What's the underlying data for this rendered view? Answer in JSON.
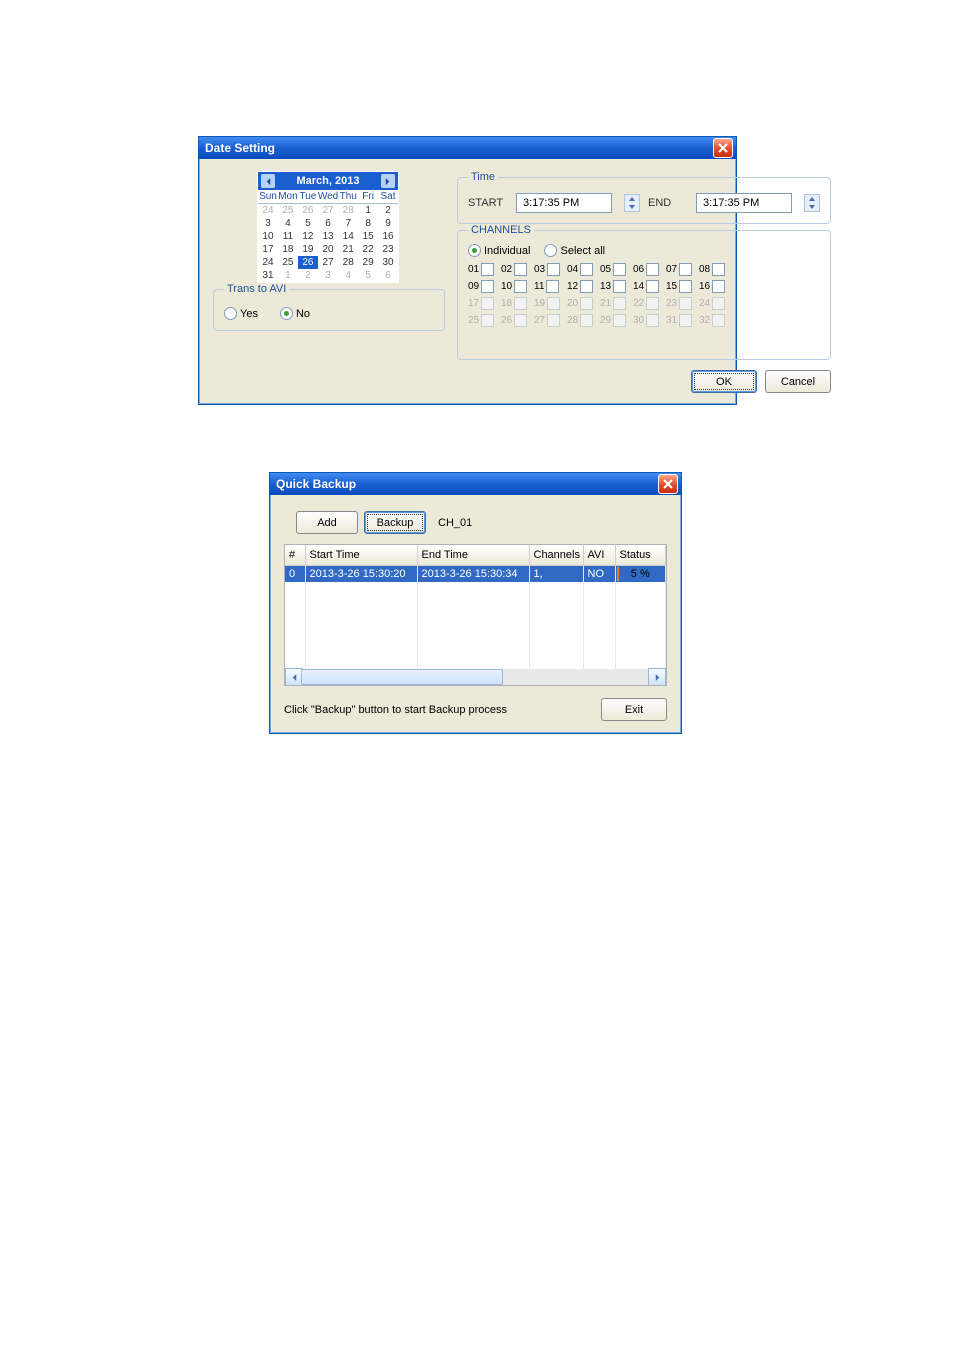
{
  "win1": {
    "title": "Date Setting",
    "calendar": {
      "month_label": "March, 2013",
      "dow": [
        "Sun",
        "Mon",
        "Tue",
        "Wed",
        "Thu",
        "Fri",
        "Sat"
      ],
      "rows": [
        [
          {
            "d": 24,
            "dim": true
          },
          {
            "d": 25,
            "dim": true
          },
          {
            "d": 26,
            "dim": true
          },
          {
            "d": 27,
            "dim": true
          },
          {
            "d": 28,
            "dim": true
          },
          {
            "d": 1
          },
          {
            "d": 2
          }
        ],
        [
          {
            "d": 3
          },
          {
            "d": 4
          },
          {
            "d": 5
          },
          {
            "d": 6
          },
          {
            "d": 7
          },
          {
            "d": 8
          },
          {
            "d": 9
          }
        ],
        [
          {
            "d": 10
          },
          {
            "d": 11
          },
          {
            "d": 12
          },
          {
            "d": 13
          },
          {
            "d": 14
          },
          {
            "d": 15
          },
          {
            "d": 16
          }
        ],
        [
          {
            "d": 17
          },
          {
            "d": 18
          },
          {
            "d": 19
          },
          {
            "d": 20
          },
          {
            "d": 21
          },
          {
            "d": 22
          },
          {
            "d": 23
          }
        ],
        [
          {
            "d": 24
          },
          {
            "d": 25
          },
          {
            "d": 26,
            "sel": true
          },
          {
            "d": 27
          },
          {
            "d": 28
          },
          {
            "d": 29
          },
          {
            "d": 30
          }
        ],
        [
          {
            "d": 31
          },
          {
            "d": 1,
            "dim": true
          },
          {
            "d": 2,
            "dim": true
          },
          {
            "d": 3,
            "dim": true
          },
          {
            "d": 4,
            "dim": true
          },
          {
            "d": 5,
            "dim": true
          },
          {
            "d": 6,
            "dim": true
          }
        ]
      ]
    },
    "trans": {
      "legend": "Trans to AVI",
      "yes": "Yes",
      "no": "No",
      "selected": "no"
    },
    "time": {
      "legend": "Time",
      "start_label": "START",
      "end_label": "END",
      "start_value": "3:17:35 PM",
      "end_value": "3:17:35 PM"
    },
    "channels": {
      "legend": "CHANNELS",
      "mode_individual": "Individual",
      "mode_selectall": "Select all",
      "mode_selected": "individual",
      "rows": [
        [
          "01",
          "02",
          "03",
          "04",
          "05",
          "06",
          "07",
          "08"
        ],
        [
          "09",
          "10",
          "11",
          "12",
          "13",
          "14",
          "15",
          "16"
        ],
        [
          "17",
          "18",
          "19",
          "20",
          "21",
          "22",
          "23",
          "24"
        ],
        [
          "25",
          "26",
          "27",
          "28",
          "29",
          "30",
          "31",
          "32"
        ]
      ],
      "disabled_rows_from": 2
    },
    "buttons": {
      "ok": "OK",
      "cancel": "Cancel"
    }
  },
  "win2": {
    "title": "Quick Backup",
    "buttons": {
      "add": "Add",
      "backup": "Backup",
      "exit": "Exit"
    },
    "ch_label": "CH_01",
    "hint": "Click \"Backup\" button to start Backup process",
    "columns": [
      "#",
      "Start Time",
      "End Time",
      "Channels",
      "AVI",
      "Status"
    ],
    "rows": [
      {
        "idx": "0",
        "start": "2013-3-26 15:30:20",
        "end": "2013-3-26 15:30:34",
        "channels": "1,",
        "avi": "NO",
        "status_pct": 5,
        "status_text": "5 %"
      }
    ]
  }
}
